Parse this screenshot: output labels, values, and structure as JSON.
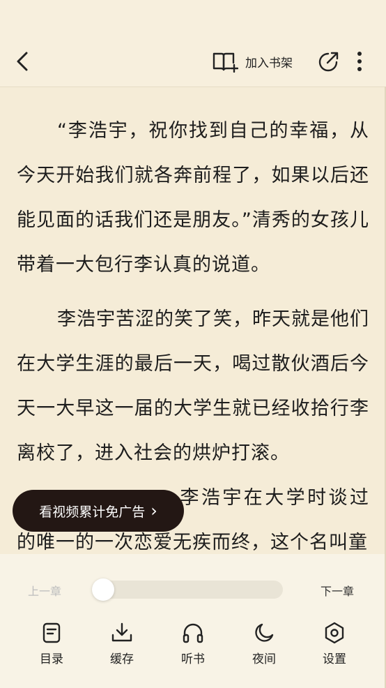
{
  "header": {
    "add_bookshelf_label": "加入书架",
    "icons": {
      "back": "chevron-left-icon",
      "bookshelf": "book-add-icon",
      "share": "share-icon",
      "more": "more-vertical-icon"
    }
  },
  "content": {
    "paragraphs": [
      "“李浩宇，祝你找到自己的幸福，从今天开始我们就各奔前程了，如果以后还能见面的话我们还是朋友。”清秀的女孩儿带着一大包行李认真的说道。",
      "李浩宇苦涩的笑了笑，昨天就是他们在大学生涯的最后一天，喝过散伙酒后今天一大早这一届的大学生就已经收拾行李离校了，进入社会的烘炉打滚。",
      "李浩宇在大学时谈过的唯一的一次恋爱无疾而终，这个名叫童"
    ]
  },
  "ad": {
    "label": "看视频累计免广告",
    "arrow": "›"
  },
  "progress": {
    "prev_label": "上一章",
    "next_label": "下一章",
    "value": 0.0
  },
  "toolbar": {
    "items": [
      {
        "label": "目录",
        "icon": "catalog-icon"
      },
      {
        "label": "缓存",
        "icon": "download-icon"
      },
      {
        "label": "听书",
        "icon": "headphones-icon"
      },
      {
        "label": "夜间",
        "icon": "moon-icon"
      },
      {
        "label": "设置",
        "icon": "settings-icon"
      }
    ]
  },
  "colors": {
    "background": "#f5ecd7",
    "panel": "#f8f3e6",
    "text": "#1d1d1d",
    "ad_bg": "#231714"
  }
}
